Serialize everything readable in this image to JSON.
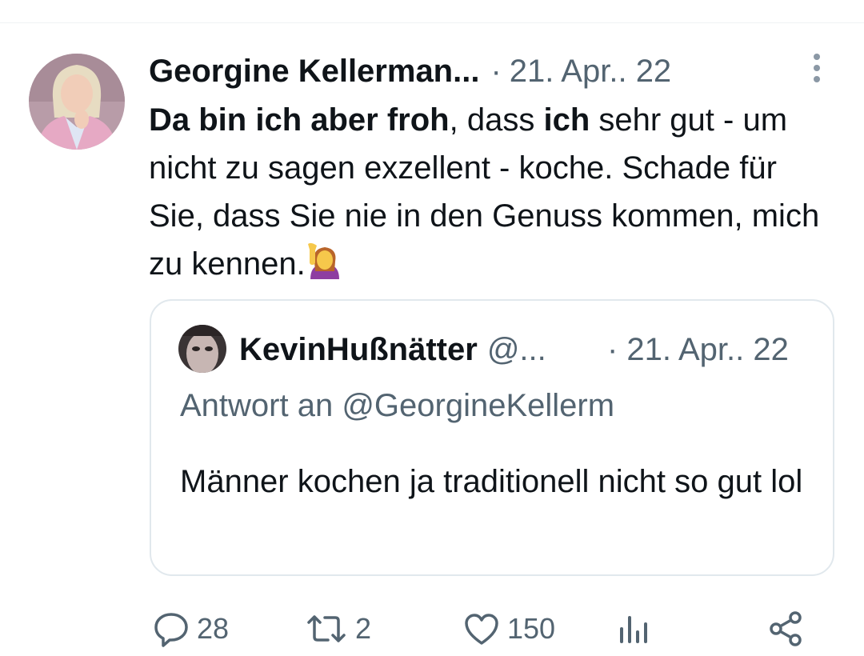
{
  "tweet": {
    "author_name": "Georgine Kellerman...",
    "separator": "·",
    "date": "21. Apr.. 22",
    "text": {
      "bold_1": "Da bin ich aber froh",
      "plain_1": ", dass ",
      "bold_2": "ich",
      "plain_2": " sehr gut - um nicht zu sagen exzellent - koche. Schade für Sie, dass Sie nie in den Genuss kommen, mich zu kennen.",
      "emoji": "person-raising-hand-emoji"
    }
  },
  "quote": {
    "author_name": "KevinHußnätter",
    "handle": "@...",
    "date": "· 21. Apr.. 22",
    "reply_to": "Antwort an @GeorgineKellerm",
    "text": "Männer kochen ja traditionell nicht so gut lol"
  },
  "actions": {
    "reply_count": "28",
    "retweet_count": "2",
    "like_count": "150",
    "icons": [
      "reply-icon",
      "retweet-icon",
      "like-icon",
      "views-icon",
      "share-icon"
    ]
  },
  "colors": {
    "text": "#0f1419",
    "secondary": "#536471",
    "border": "#e1e8ed"
  }
}
